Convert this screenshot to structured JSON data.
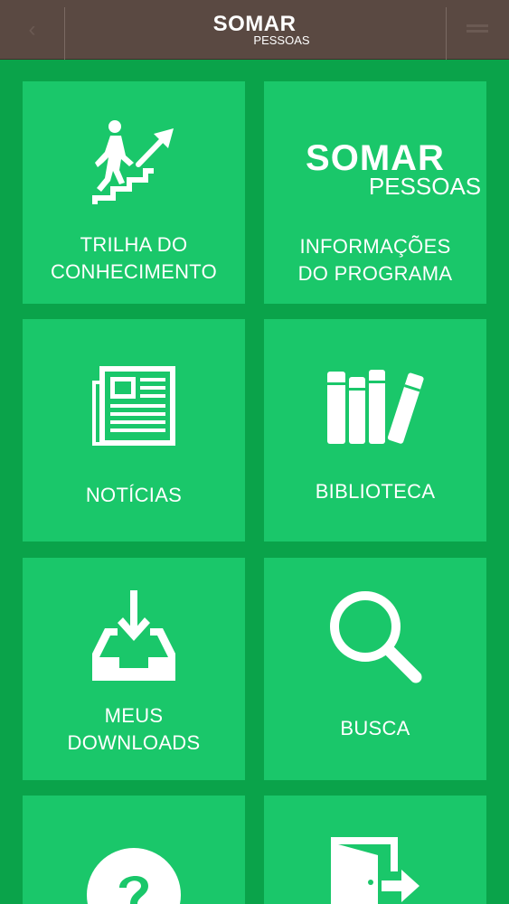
{
  "header": {
    "brand_main": "SOMAR",
    "brand_sub": "PESSOAS",
    "back_icon": "chevron-left-icon",
    "menu_icon": "hamburger-menu-icon"
  },
  "tiles": [
    {
      "label_line1": "TRILHA DO",
      "label_line2": "CONHECIMENTO",
      "icon": "stairs-climb-icon"
    },
    {
      "label_line1": "INFORMAÇÕES",
      "label_line2": "DO PROGRAMA",
      "logo_main": "SOMAR",
      "logo_sub": "PESSOAS"
    },
    {
      "label_line1": "NOTÍCIAS",
      "icon": "newspaper-icon"
    },
    {
      "label_line1": "BIBLIOTECA",
      "icon": "books-icon"
    },
    {
      "label_line1": "MEUS",
      "label_line2": "DOWNLOADS",
      "icon": "download-tray-icon"
    },
    {
      "label_line1": "BUSCA",
      "icon": "magnifier-icon"
    },
    {
      "icon": "help-question-icon"
    },
    {
      "icon": "exit-door-icon"
    }
  ],
  "colors": {
    "background": "#0aa34a",
    "tile": "#1ac76a",
    "header": "#5a4942"
  }
}
